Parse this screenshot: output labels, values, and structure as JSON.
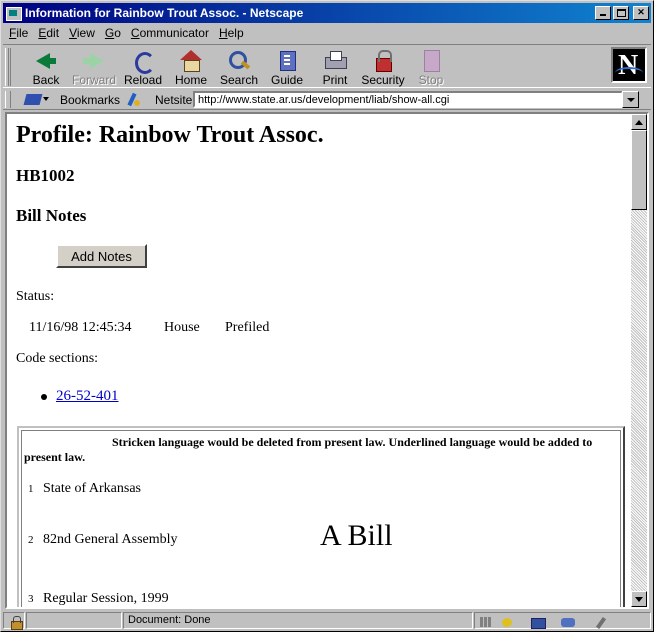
{
  "window": {
    "title": "Information for Rainbow Trout Assoc. - Netscape"
  },
  "menu": [
    {
      "label": "File",
      "accel": "F",
      "rest": "ile"
    },
    {
      "label": "Edit",
      "accel": "E",
      "rest": "dit"
    },
    {
      "label": "View",
      "accel": "V",
      "rest": "iew"
    },
    {
      "label": "Go",
      "accel": "G",
      "rest": "o"
    },
    {
      "label": "Communicator",
      "accel": "C",
      "rest": "ommunicator"
    },
    {
      "label": "Help",
      "accel": "H",
      "rest": "elp"
    }
  ],
  "toolbar": {
    "back": "Back",
    "forward": "Forward",
    "reload": "Reload",
    "home": "Home",
    "search": "Search",
    "guide": "Guide",
    "print": "Print",
    "security": "Security",
    "stop": "Stop"
  },
  "location": {
    "bookmarks": "Bookmarks",
    "netsite_label": "Netsite:",
    "url": "http://www.state.ar.us/development/liab/show-all.cgi"
  },
  "page": {
    "profile_title": "Profile: Rainbow Trout Assoc.",
    "bill_id": "HB1002",
    "notes_heading": "Bill Notes",
    "add_notes_button": "Add Notes",
    "status_label": "Status:",
    "status": {
      "datetime": "11/16/98 12:45:34",
      "chamber": "House",
      "state": "Prefiled"
    },
    "code_sections_label": "Code sections:",
    "code_sections": [
      "26-52-401"
    ],
    "bill": {
      "legend": "Stricken language would be deleted from present law. Underlined language would be added to present law.",
      "lines": [
        {
          "num": "1",
          "text": "State of Arkansas"
        },
        {
          "num": "2",
          "text": "82nd General Assembly"
        },
        {
          "num": "3",
          "text": "Regular Session, 1999"
        }
      ],
      "title": "A Bill"
    }
  },
  "statusbar": {
    "text": "Document: Done"
  }
}
